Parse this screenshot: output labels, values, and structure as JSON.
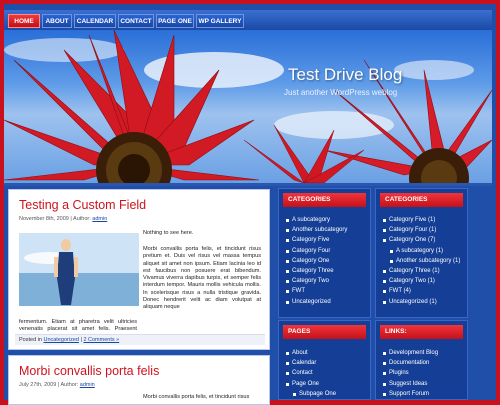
{
  "nav": {
    "items": [
      "HOME",
      "ABOUT",
      "CALENDAR",
      "CONTACT",
      "PAGE ONE",
      "WP GALLERY"
    ]
  },
  "header": {
    "title": "Test Drive Blog",
    "tagline": "Just another WordPress weblog"
  },
  "posts": [
    {
      "title": "Testing a Custom Field",
      "date": "November 8th, 2009",
      "author_label": "| Author:",
      "author": "admin",
      "lead": "Nothing to see here.",
      "body_side": "Morbi convallis porta felis, et tincidunt risus pretium et. Duis vel risus vel massa tempus aliquet sit amet non ipsum. Etiam lacinia leo id est faucibus non posuere erat bibendum. Vivamus viverra dapibus turpis, et semper felis interdum tempor. Mauris mollis vehicula mollis. In scelerisque risus a nulla tristique gravida. Donec hendrerit velit ac diam volutpat at aliquam neque",
      "body_full": "fermentum. Etiam at pharetra velit ultricies venenatis placerat sit amet felis. Praesent convallis, ipsum non elementum.",
      "posted_in": "Posted in",
      "category": "Uncategorized",
      "separator": "|",
      "comments": "2 Comments »"
    },
    {
      "title": "Morbi convallis porta felis",
      "date": "July 27th, 2009",
      "author_label": "| Author:",
      "author": "admin",
      "body_start": "Morbi convallis porta felis, et tincidunt risus"
    }
  ],
  "sidebar_left": {
    "categories_title": "CATEGORIES",
    "categories": [
      "A subcategory",
      "Another subcategory",
      "Category Five",
      "Category Four",
      "Category One",
      "Category Three",
      "Category Two",
      "FWT",
      "Uncategorized"
    ],
    "pages_title": "PAGES",
    "pages": [
      "About",
      "Calendar",
      "Contact",
      "Page One",
      "Subpage One"
    ]
  },
  "sidebar_right": {
    "categories_title": "CATEGORIES",
    "categories": [
      "Category Five (1)",
      "Category Four (1)",
      "Category One (7)",
      "A subcategory (1)",
      "Another subcategory (1)",
      "Category Three (1)",
      "Category Two (1)",
      "FWT (4)",
      "Uncategorized (1)"
    ],
    "links_title": "LINKS:",
    "links": [
      "Development Blog",
      "Documentation",
      "Plugins",
      "Suggest Ideas",
      "Support Forum"
    ]
  },
  "colors": {
    "brand_red": "#d0121e",
    "nav_blue": "#1b4aa6",
    "sidebar_blue": "#153f96"
  }
}
